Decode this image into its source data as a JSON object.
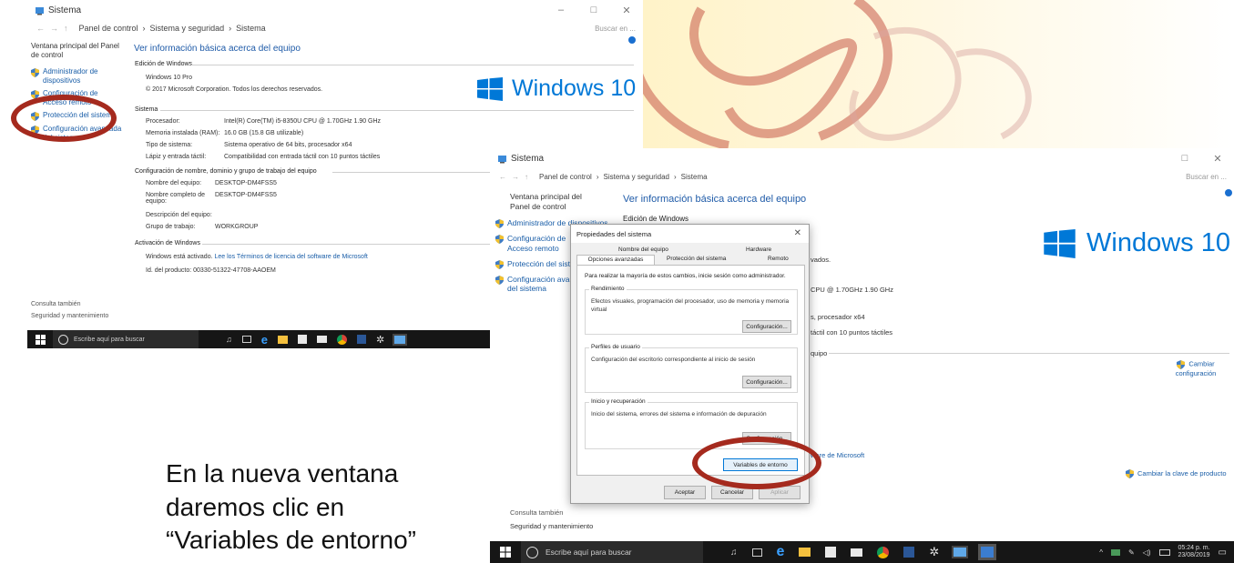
{
  "left_window": {
    "title": "Sistema",
    "breadcrumb": [
      "Panel de control",
      "Sistema y seguridad",
      "Sistema"
    ],
    "search_placeholder": "Buscar en ...",
    "nav_home": "Ventana principal del Panel de control",
    "nav_items": [
      {
        "label": "Administrador de dispositivos"
      },
      {
        "label": "Configuración de Acceso remoto"
      },
      {
        "label": "Protección del sistema"
      },
      {
        "label": "Configuración avanzada del sistema"
      }
    ],
    "heading": "Ver información básica acerca del equipo",
    "edition_title": "Edición de Windows",
    "edition_name": "Windows 10 Pro",
    "copyright": "© 2017 Microsoft Corporation. Todos los derechos reservados.",
    "logo_text": "Windows 10",
    "system_title": "Sistema",
    "system_rows": [
      {
        "k": "Procesador:",
        "v": "Intel(R) Core(TM) i5-8350U CPU @ 1.70GHz   1.90 GHz"
      },
      {
        "k": "Memoria instalada (RAM):",
        "v": "16.0 GB (15.8 GB utilizable)"
      },
      {
        "k": "Tipo de sistema:",
        "v": "Sistema operativo de 64 bits, procesador x64"
      },
      {
        "k": "Lápiz y entrada táctil:",
        "v": "Compatibilidad con entrada táctil con 10 puntos táctiles"
      }
    ],
    "name_title": "Configuración de nombre, dominio y grupo de trabajo del equipo",
    "name_rows": [
      {
        "k": "Nombre del equipo:",
        "v": "DESKTOP-DM4FSS5"
      },
      {
        "k": "Nombre completo de equipo:",
        "v": "DESKTOP-DM4FSS5"
      },
      {
        "k": "Descripción del equipo:",
        "v": ""
      },
      {
        "k": "Grupo de trabajo:",
        "v": "WORKGROUP"
      }
    ],
    "activation_title": "Activación de Windows",
    "activation_text": "Windows está activado.",
    "activation_link": "Lee los Términos de licencia del software de Microsoft",
    "product_id": "Id. del producto: 00330-51322-47708-AAOEM",
    "see_also_title": "Consulta también",
    "see_also_item": "Seguridad y mantenimiento",
    "taskbar_search": "Escribe aquí para buscar"
  },
  "right_window": {
    "title": "Sistema",
    "breadcrumb": [
      "Panel de control",
      "Sistema y seguridad",
      "Sistema"
    ],
    "search_placeholder": "Buscar en ...",
    "nav_home": "Ventana principal del Panel de control",
    "nav_items": [
      {
        "label": "Administrador de dispositivos"
      },
      {
        "label": "Configuración de Acceso remoto"
      },
      {
        "label": "Protección del sistema"
      },
      {
        "label": "Configuración avanzada del sistema"
      }
    ],
    "heading": "Ver información básica acerca del equipo",
    "edition_title": "Edición de Windows",
    "logo_text": "Windows 10",
    "frag_copyright": "vados.",
    "frag_cpu": "CPU @ 1.70GHz   1.90 GHz",
    "frag_arch": "s, procesador x64",
    "frag_touch": "táctil con 10 puntos táctiles",
    "frag_group": "quipo",
    "change_config": "Cambiar configuración",
    "frag_license": "ware de Microsoft",
    "change_key": "Cambiar la clave de producto",
    "see_also_title": "Consulta también",
    "see_also_item": "Seguridad y mantenimiento",
    "taskbar_search": "Escribe aquí para buscar",
    "clock_time": "05:24 p. m.",
    "clock_date": "23/08/2019"
  },
  "dialog": {
    "title": "Propiedades del sistema",
    "tabs": [
      "Nombre del equipo",
      "Hardware",
      "Opciones avanzadas",
      "Protección del sistema",
      "Remoto"
    ],
    "admin_note": "Para realizar la mayoría de estos cambios, inicie sesión como administrador.",
    "groups": [
      {
        "label": "Rendimiento",
        "text": "Efectos visuales, programación del procesador, uso de memoria y memoria virtual",
        "button": "Configuración..."
      },
      {
        "label": "Perfiles de usuario",
        "text": "Configuración del escritorio correspondiente al inicio de sesión",
        "button": "Configuración..."
      },
      {
        "label": "Inicio y recuperación",
        "text": "Inicio del sistema, errores del sistema e información de depuración",
        "button": "Configuración..."
      }
    ],
    "env_button": "Variables de entorno",
    "ok": "Aceptar",
    "cancel": "Cancelar",
    "apply": "Aplicar"
  },
  "caption": {
    "line1": "En la nueva ventana",
    "line2": "daremos clic en",
    "line3": "“Variables de entorno”"
  },
  "colors": {
    "highlight_circle": "#a52a1e",
    "link": "#1a5ea8",
    "windows_blue": "#0078d7",
    "taskbar": "#161616"
  }
}
